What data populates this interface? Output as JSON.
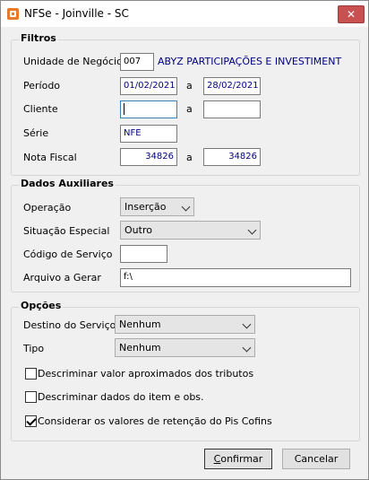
{
  "window": {
    "title": "NFSe - Joinville - SC",
    "close_symbol": "✕"
  },
  "filtros": {
    "legend": "Filtros",
    "unidade_label": "Unidade de Negócio",
    "unidade_code": "007",
    "unidade_name": "ABYZ PARTICIPAÇÕES E INVESTIMENT",
    "periodo_label": "Período",
    "periodo_from": "01/02/2021",
    "periodo_a": "a",
    "periodo_to": "28/02/2021",
    "cliente_label": "Cliente",
    "cliente_from": "",
    "cliente_a": "a",
    "cliente_to": "",
    "serie_label": "Série",
    "serie_value": "NFE",
    "nf_label": "Nota Fiscal",
    "nf_from": "34826",
    "nf_a": "a",
    "nf_to": "34826"
  },
  "dados": {
    "legend": "Dados Auxiliares",
    "operacao_label": "Operação",
    "operacao_value": "Inserção",
    "situacao_label": "Situação Especial",
    "situacao_value": "Outro",
    "codigo_label": "Código de Serviço",
    "codigo_value": "",
    "arquivo_label": "Arquivo a Gerar",
    "arquivo_value": "f:\\"
  },
  "opcoes": {
    "legend": "Opções",
    "destino_label": "Destino do Serviço",
    "destino_value": "Nenhum",
    "tipo_label": "Tipo",
    "tipo_value": "Nenhum",
    "chk1_label": "Descriminar valor aproximados dos tributos",
    "chk1_checked": false,
    "chk2_label": "Descriminar dados do item e obs.",
    "chk2_checked": false,
    "chk3_label": "Considerar os valores de retenção do Pis Cofins",
    "chk3_checked": true
  },
  "buttons": {
    "confirmar_first": "C",
    "confirmar_rest": "onfirmar",
    "cancelar": "Cancelar"
  }
}
